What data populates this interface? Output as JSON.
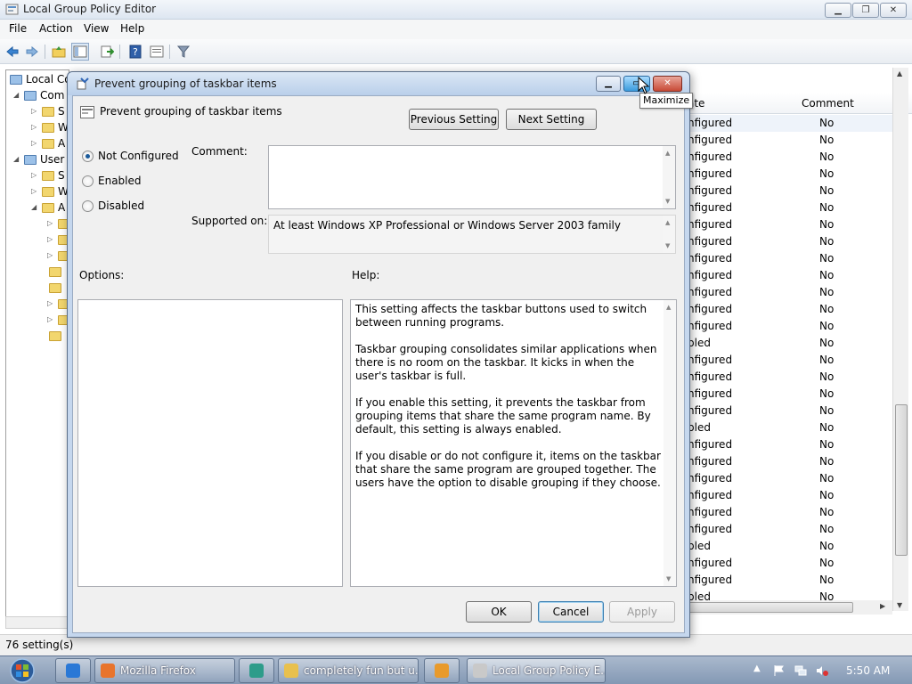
{
  "window": {
    "title": "Local Group Policy Editor",
    "min": "▁",
    "max": "❐",
    "close": "✕"
  },
  "menu": [
    "File",
    "Action",
    "View",
    "Help"
  ],
  "tree": [
    {
      "label": "Local Co",
      "twisty": "",
      "indent": 0
    },
    {
      "label": "Com",
      "twisty": "◢",
      "indent": 1
    },
    {
      "label": "S",
      "twisty": "▷",
      "indent": 2
    },
    {
      "label": "W",
      "twisty": "▷",
      "indent": 2
    },
    {
      "label": "A",
      "twisty": "▷",
      "indent": 2
    },
    {
      "label": "User",
      "twisty": "◢",
      "indent": 1
    },
    {
      "label": "S",
      "twisty": "▷",
      "indent": 2
    },
    {
      "label": "W",
      "twisty": "▷",
      "indent": 2
    },
    {
      "label": "A",
      "twisty": "◢",
      "indent": 2
    },
    {
      "label": "",
      "twisty": "▷",
      "indent": 3
    },
    {
      "label": "",
      "twisty": "▷",
      "indent": 3
    },
    {
      "label": "",
      "twisty": "▷",
      "indent": 3
    },
    {
      "label": "",
      "twisty": "",
      "indent": 3
    },
    {
      "label": "",
      "twisty": "",
      "indent": 3
    },
    {
      "label": "",
      "twisty": "▷",
      "indent": 3
    },
    {
      "label": "",
      "twisty": "▷",
      "indent": 3
    },
    {
      "label": "",
      "twisty": "",
      "indent": 3
    }
  ],
  "list": {
    "header_state": "ate",
    "header_comment": "Comment",
    "rows": [
      {
        "state": "nfigured",
        "comment": "No"
      },
      {
        "state": "nfigured",
        "comment": "No"
      },
      {
        "state": "nfigured",
        "comment": "No"
      },
      {
        "state": "nfigured",
        "comment": "No"
      },
      {
        "state": "nfigured",
        "comment": "No"
      },
      {
        "state": "nfigured",
        "comment": "No"
      },
      {
        "state": "nfigured",
        "comment": "No"
      },
      {
        "state": "nfigured",
        "comment": "No"
      },
      {
        "state": "nfigured",
        "comment": "No"
      },
      {
        "state": "nfigured",
        "comment": "No"
      },
      {
        "state": "nfigured",
        "comment": "No"
      },
      {
        "state": "nfigured",
        "comment": "No"
      },
      {
        "state": "nfigured",
        "comment": "No"
      },
      {
        "state": "bled",
        "comment": "No"
      },
      {
        "state": "nfigured",
        "comment": "No"
      },
      {
        "state": "nfigured",
        "comment": "No"
      },
      {
        "state": "nfigured",
        "comment": "No"
      },
      {
        "state": "nfigured",
        "comment": "No"
      },
      {
        "state": "bled",
        "comment": "No"
      },
      {
        "state": "nfigured",
        "comment": "No"
      },
      {
        "state": "nfigured",
        "comment": "No"
      },
      {
        "state": "nfigured",
        "comment": "No"
      },
      {
        "state": "nfigured",
        "comment": "No"
      },
      {
        "state": "nfigured",
        "comment": "No"
      },
      {
        "state": "nfigured",
        "comment": "No"
      },
      {
        "state": "bled",
        "comment": "No"
      },
      {
        "state": "nfigured",
        "comment": "No"
      },
      {
        "state": "nfigured",
        "comment": "No"
      },
      {
        "state": "bled",
        "comment": "No"
      }
    ]
  },
  "status": "76 setting(s)",
  "dialog": {
    "title": "Prevent grouping of taskbar items",
    "setting_name": "Prevent grouping of taskbar items",
    "prev_button": "Previous Setting",
    "next_button": "Next Setting",
    "radios": [
      {
        "label": "Not Configured",
        "checked": true
      },
      {
        "label": "Enabled",
        "checked": false
      },
      {
        "label": "Disabled",
        "checked": false
      }
    ],
    "comment_label": "Comment:",
    "comment_value": "",
    "supported_label": "Supported on:",
    "supported_value": "At least Windows XP Professional or Windows Server 2003 family",
    "options_label": "Options:",
    "help_label": "Help:",
    "help_paragraphs": [
      "This setting affects the taskbar buttons used to switch between running programs.",
      "Taskbar grouping consolidates similar applications when there is no room on the taskbar. It kicks in when the user's taskbar is full.",
      "If you enable this setting, it prevents the taskbar from grouping items that share the same program name. By default, this setting is always enabled.",
      "If you disable or do not configure it, items on the taskbar that share the same program are grouped together. The users have the option to disable grouping if they choose."
    ],
    "ok": "OK",
    "cancel": "Cancel",
    "apply": "Apply"
  },
  "tooltip": "Maximize",
  "taskbar": {
    "buttons": [
      {
        "label": "",
        "icon": "ie-icon",
        "color": "#2a78d6"
      },
      {
        "label": "Mozilla Firefox",
        "icon": "firefox-icon",
        "color": "#e8742c"
      },
      {
        "label": "",
        "icon": "app-icon",
        "color": "#2d9c8a"
      },
      {
        "label": "completely fun but u...",
        "icon": "folder-icon",
        "color": "#e8c04d"
      },
      {
        "label": "",
        "icon": "media-icon",
        "color": "#e89a2c"
      },
      {
        "label": "Local Group Policy E...",
        "icon": "policy-icon",
        "color": "#c9c9c9"
      }
    ],
    "clock": "5:50 AM"
  },
  "colors": {
    "accent": "#1a5a9a",
    "close_red": "#c84a36"
  }
}
